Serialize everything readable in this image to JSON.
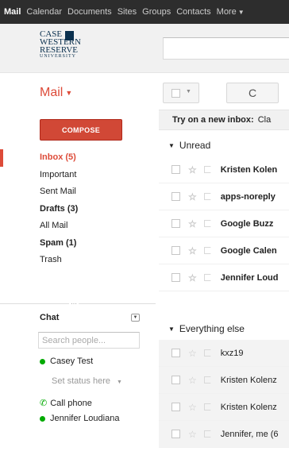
{
  "topbar": {
    "items": [
      "Mail",
      "Calendar",
      "Documents",
      "Sites",
      "Groups",
      "Contacts",
      "More"
    ]
  },
  "logo": {
    "line1": "CASE",
    "line2": "WESTERN",
    "line3": "RESERVE",
    "line4": "UNIVERSITY"
  },
  "mail_title": "Mail",
  "compose_label": "COMPOSE",
  "nav": {
    "items": [
      {
        "label": "Inbox (5)"
      },
      {
        "label": "Important"
      },
      {
        "label": "Sent Mail"
      },
      {
        "label": "Drafts (3)"
      },
      {
        "label": "All Mail"
      },
      {
        "label": "Spam (1)"
      },
      {
        "label": "Trash"
      }
    ]
  },
  "chat": {
    "title": "Chat",
    "search_placeholder": "Search people...",
    "user": "Casey Test",
    "status": "Set status here",
    "call_phone": "Call phone",
    "contact": "Jennifer Loudiana"
  },
  "toolbar": {
    "refresh_glyph": "C"
  },
  "inbox_tip": {
    "bold": "Try on a new inbox:",
    "text": "Cla"
  },
  "sections": {
    "unread": "Unread",
    "everything_else": "Everything else"
  },
  "unread_rows": [
    {
      "sender": "Kristen Kolen"
    },
    {
      "sender": "apps-noreply"
    },
    {
      "sender": "Google Buzz"
    },
    {
      "sender": "Google Calen"
    },
    {
      "sender": "Jennifer Loud"
    }
  ],
  "other_rows": [
    {
      "sender": "kxz19"
    },
    {
      "sender": "Kristen Kolenz"
    },
    {
      "sender": "Kristen Kolenz"
    },
    {
      "sender": "Jennifer, me (6"
    }
  ],
  "colors": {
    "accent_red": "#dd4b39",
    "compose_bg": "#d14836",
    "topbar_bg": "#2d2d2d",
    "online_green": "#00aa00"
  }
}
